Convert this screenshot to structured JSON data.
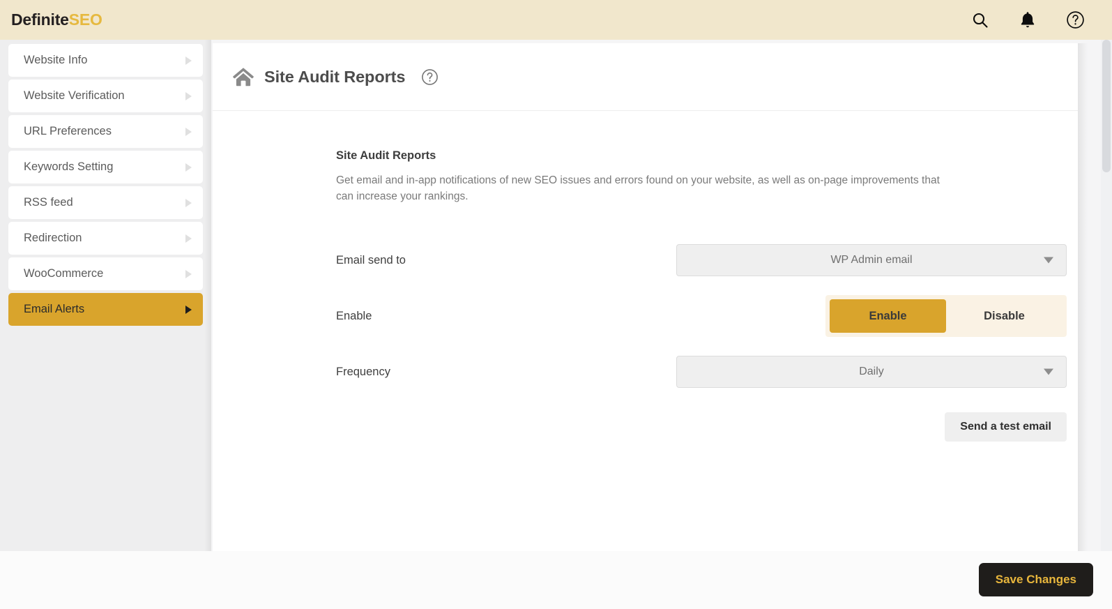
{
  "brand": {
    "name_primary": "Definite",
    "name_accent": "SEO",
    "accent_color": "#e6b93f",
    "header_bg": "#f1e7cc"
  },
  "topbar": {
    "icons": [
      {
        "name": "search-icon",
        "label": "Search"
      },
      {
        "name": "bell-icon",
        "label": "Notifications"
      },
      {
        "name": "help-circle-icon",
        "label": "Help"
      }
    ]
  },
  "sidebar": {
    "items": [
      {
        "label": "Website Info",
        "active": false
      },
      {
        "label": "Website Verification",
        "active": false
      },
      {
        "label": "URL Preferences",
        "active": false
      },
      {
        "label": "Keywords Setting",
        "active": false
      },
      {
        "label": "RSS feed",
        "active": false
      },
      {
        "label": "Redirection",
        "active": false
      },
      {
        "label": "WooCommerce",
        "active": false
      },
      {
        "label": "Email Alerts",
        "active": true
      }
    ],
    "active_bg": "#d9a42c"
  },
  "page": {
    "title": "Site Audit Reports",
    "home_icon": "home-icon",
    "help_icon": "help-circle-icon"
  },
  "section": {
    "title": "Site Audit Reports",
    "description": "Get email and in-app notifications of new SEO issues and errors found on your website, as well as on-page improvements that can increase your rankings."
  },
  "fields": {
    "email_send_to": {
      "label": "Email send to",
      "value": "WP Admin email",
      "options": [
        "WP Admin email"
      ]
    },
    "enable": {
      "label": "Enable",
      "enable_label": "Enable",
      "disable_label": "Disable",
      "selected": "Enable"
    },
    "frequency": {
      "label": "Frequency",
      "value": "Daily",
      "options": [
        "Daily"
      ]
    }
  },
  "actions": {
    "test_email_label": "Send a test email",
    "save_label": "Save Changes",
    "save_bg": "#1f1d1b",
    "save_text_color": "#e8b63c"
  }
}
